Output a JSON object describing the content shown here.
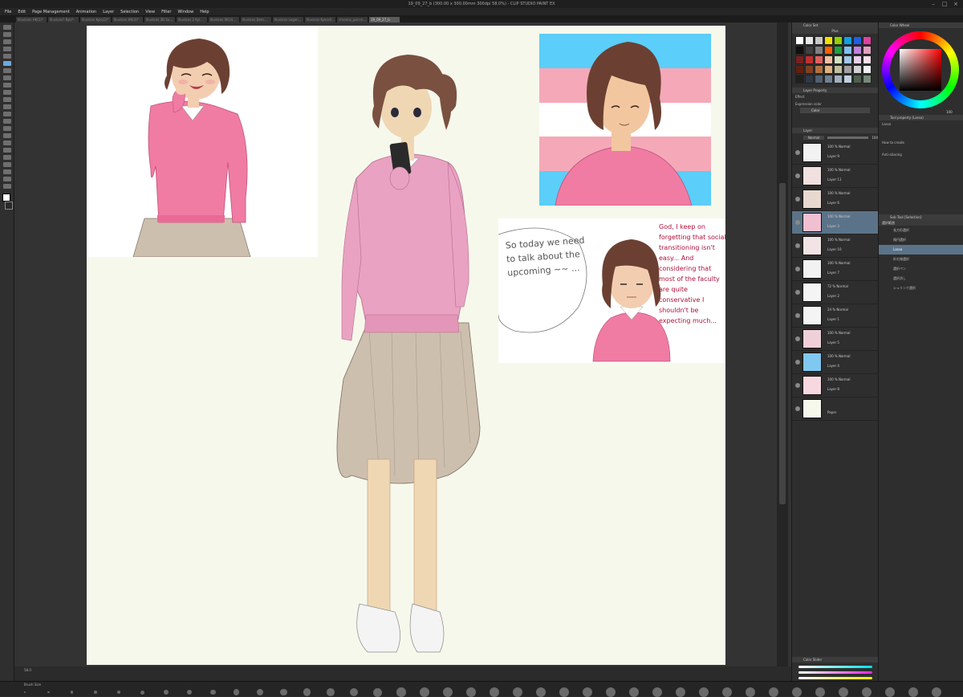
{
  "window": {
    "title": "19_09_27_b (300.00 x 300.00mm 300dpi 58.0%) - CLIP STUDIO PAINT EX"
  },
  "menu": [
    "File",
    "Edit",
    "Page Management",
    "Animation",
    "Layer",
    "Selection",
    "View",
    "Filter",
    "Window",
    "Help"
  ],
  "tabs": [
    {
      "label": "Illlusions HK(1)*"
    },
    {
      "label": "Illusions? Kyle*"
    },
    {
      "label": "Illusions Kylo(2)*"
    },
    {
      "label": "Illusions HK(3)*"
    },
    {
      "label": "Illusions 3D Su..."
    },
    {
      "label": "Illusions 2 Kyl..."
    },
    {
      "label": "Illusions SK(3)..."
    },
    {
      "label": "Illusions Dem..."
    },
    {
      "label": "Illusions Legen..."
    },
    {
      "label": "Illusions Kyle(d)..."
    },
    {
      "label": "chronos_pal.nn..."
    },
    {
      "label": "19_09_27_b"
    }
  ],
  "colorset": {
    "title": "Color Set",
    "preset": "Plus",
    "colors": [
      "#ffffff",
      "#e8e8e8",
      "#c8c8c8",
      "#f0e000",
      "#90d000",
      "#10a0e0",
      "#2060e0",
      "#e040a0",
      "#101010",
      "#404040",
      "#808080",
      "#ff6000",
      "#20a040",
      "#80c0f0",
      "#c080e0",
      "#e0a0c0",
      "#7a2020",
      "#c03030",
      "#e06060",
      "#f0c0a0",
      "#d0e0c0",
      "#a0c8e8",
      "#e8d0e8",
      "#f8e0e8",
      "#602010",
      "#804020",
      "#b07040",
      "#e0b080",
      "#c0c0a0",
      "#a0a0a0",
      "#d0d0d0",
      "#f0f0f0",
      "#202020",
      "#303848",
      "#506070",
      "#708090",
      "#a0b0c0",
      "#c0d0e0",
      "#506050",
      "#788878"
    ]
  },
  "colorwheel": {
    "title": "Color Wheel",
    "hue_label": "H",
    "value": "100"
  },
  "layer_property": {
    "title": "Layer Property",
    "effect_label": "Effect",
    "expression_label": "Expression color",
    "expression_value": "Color"
  },
  "subtool_detail": {
    "title": "Tool property (Lasso)",
    "tab": "Lasso",
    "how_to_create": "How to create",
    "anti_aliasing": "Anti-aliasing"
  },
  "layer_panel": {
    "title": "Layer",
    "blend_mode": "Normal",
    "opacity": "100",
    "layers": [
      {
        "mode": "100 % Normal",
        "name": "Layer 9",
        "thumb": "#f2f2f2"
      },
      {
        "mode": "100 % Normal",
        "name": "Layer 11",
        "thumb": "#f0e0e0"
      },
      {
        "mode": "100 % Normal",
        "name": "Layer 6",
        "thumb": "#e8d8d0"
      },
      {
        "mode": "100 % Normal",
        "name": "Layer 3",
        "thumb": "#f0c0d0",
        "selected": true
      },
      {
        "mode": "100 % Normal",
        "name": "Layer 10",
        "thumb": "#f2e4e4"
      },
      {
        "mode": "100 % Normal",
        "name": "Layer 7",
        "thumb": "#f2f2f2"
      },
      {
        "mode": "72 % Normal",
        "name": "Layer 2",
        "thumb": "#f4f4f4"
      },
      {
        "mode": "24 % Normal",
        "name": "Layer 1",
        "thumb": "#f4f4f4"
      },
      {
        "mode": "100 % Normal",
        "name": "Layer 5",
        "thumb": "#f0d0d8"
      },
      {
        "mode": "100 % Normal",
        "name": "Layer 4",
        "thumb": "#80c8f0"
      },
      {
        "mode": "100 % Normal",
        "name": "Layer 8",
        "thumb": "#f8d8e0"
      },
      {
        "mode": "",
        "name": "Paper",
        "thumb": "#f7f8ec"
      }
    ]
  },
  "subtool_panel": {
    "title": "Sub Tool [Selection]",
    "group": "選択範囲",
    "items": [
      {
        "label": "長方形選択"
      },
      {
        "label": "楕円選択"
      },
      {
        "label": "Lasso",
        "selected": true
      },
      {
        "label": "折れ線選択"
      },
      {
        "label": "選択ペン"
      },
      {
        "label": "選択消し"
      },
      {
        "label": "シュリンク選択"
      }
    ]
  },
  "color_slider": {
    "title": "Color Slider",
    "values": [
      "255",
      "255",
      "255"
    ]
  },
  "status": {
    "zoom": "58.0",
    "brush_size_label": "Brush Size"
  },
  "comic": {
    "left_speech": "So today we need to talk about the upcoming ~~ ...",
    "right_thought": "God, I keep on forgetting that social transitioning isn't easy... And considering that most of the faculty are quite conservative I shouldn't be expecting much..."
  },
  "accent": {
    "sweater": "#f07ca3",
    "hair": "#6b4032",
    "skirt": "#cdbfae",
    "flag_blue": "#5bcefa",
    "flag_pink": "#f5a9b8"
  }
}
